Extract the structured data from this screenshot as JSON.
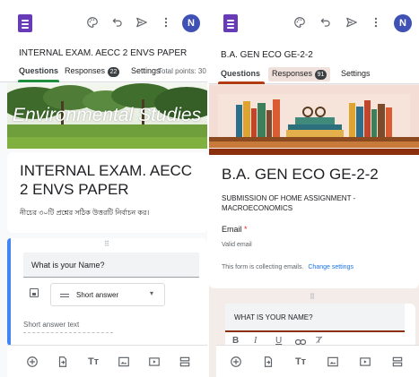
{
  "left": {
    "avatar_letter": "N",
    "form_title": "INTERNAL EXAM. AECC 2 ENVS PAPER",
    "tabs": {
      "questions": "Questions",
      "responses": "Responses",
      "responses_count": "22",
      "settings": "Settings",
      "total_points": "Total points: 30"
    },
    "banner_text": "Environmental Studies",
    "header_title": "INTERNAL EXAM. AECC 2 ENVS PAPER",
    "header_desc": "নীচের ৩০টি প্রশ্নের সঠিক উত্তরটি নির্বাচন কর।",
    "question": {
      "title": "What is your Name?",
      "type_label": "Short answer",
      "answer_placeholder": "Short answer text"
    },
    "colors": {
      "accent": "#673ab7",
      "tab_active": "#1e8e3e",
      "question_bar": "#4285f4"
    }
  },
  "right": {
    "avatar_letter": "N",
    "form_title": "B.A. GEN ECO GE-2-2",
    "tabs": {
      "questions": "Questions",
      "responses": "Responses",
      "responses_count": "91",
      "settings": "Settings"
    },
    "header_title": "B.A. GEN ECO GE-2-2",
    "header_desc": "SUBMISSION OF HOME ASSIGNMENT - MACROECONOMICS",
    "email": {
      "label": "Email",
      "required_mark": "*",
      "placeholder": "Valid email",
      "collecting_note": "This form is collecting emails.",
      "change_settings": "Change settings"
    },
    "question": {
      "title": "WHAT IS YOUR NAME?"
    },
    "format": {
      "bold": "B",
      "italic": "I",
      "underline": "U"
    },
    "colors": {
      "accent": "#8b2f0f",
      "tab_active": "#b23b14"
    }
  }
}
